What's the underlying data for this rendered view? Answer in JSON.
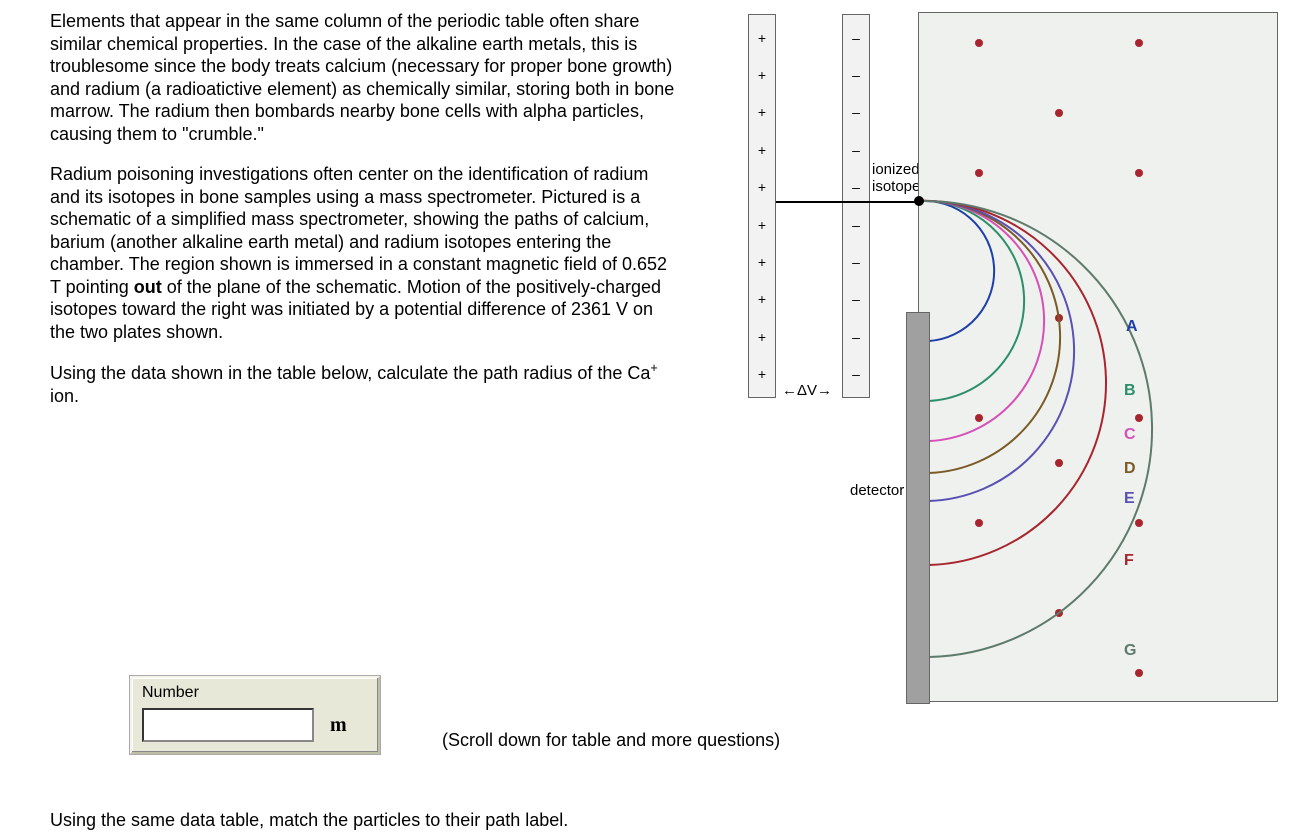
{
  "paragraphs": {
    "p1": "Elements that appear in the same column of the periodic table often share similar chemical properties. In the case of the alkaline earth metals, this is troublesome since the body treats calcium (necessary for proper bone growth) and radium (a radioatictive element) as chemically similar, storing both in bone marrow. The radium then bombards nearby bone cells with alpha particles, causing them to \"crumble.\"",
    "p2_a": "Radium poisoning investigations often center on the identification of radium and its isotopes in bone samples using a mass spectrometer. Pictured is a schematic of a simplified mass spectrometer, showing the paths of calcium, barium (another alkaline earth metal) and radium isotopes entering the chamber. The region shown is immersed in a constant magnetic field of 0.652 T pointing ",
    "p2_b": "out",
    "p2_c": " of the plane of the schematic. Motion of the positively-charged isotopes toward the right was initiated by a potential difference of 2361 V on the two plates shown.",
    "p3_a": "Using the data shown in the table below, calculate the path radius of the Ca",
    "p3_sup": "+",
    "p3_b": " ion."
  },
  "answer": {
    "label": "Number",
    "value": "",
    "unit": "m"
  },
  "scroll_note": "(Scroll down for table and more questions)",
  "match_question": "Using the same data table, match the particles to their path label.",
  "diagram": {
    "plus": "+",
    "minus": "–",
    "delta_v": "←ΔV→",
    "ionized": "ionized",
    "isotope": "isotope",
    "detector": "detector",
    "paths": {
      "A": "A",
      "B": "B",
      "C": "C",
      "D": "D",
      "E": "E",
      "F": "F",
      "G": "G"
    }
  },
  "physics": {
    "magnetic_field_T": 0.652,
    "potential_difference_V": 2361,
    "ion": "Ca+"
  }
}
